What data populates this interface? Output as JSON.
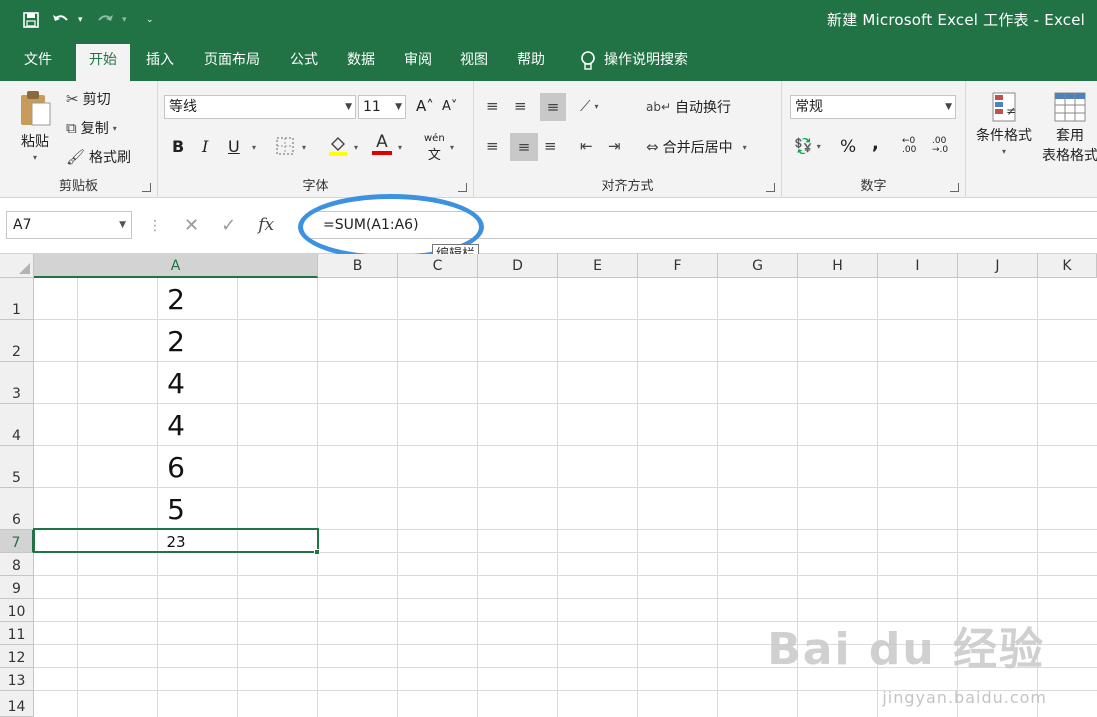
{
  "window": {
    "title": "新建 Microsoft Excel 工作表  -  Excel"
  },
  "tabs": [
    {
      "label": "文件"
    },
    {
      "label": "开始"
    },
    {
      "label": "插入"
    },
    {
      "label": "页面布局"
    },
    {
      "label": "公式"
    },
    {
      "label": "数据"
    },
    {
      "label": "审阅"
    },
    {
      "label": "视图"
    },
    {
      "label": "帮助"
    }
  ],
  "tell_me": "操作说明搜索",
  "ribbon": {
    "clipboard": {
      "label": "剪贴板",
      "paste": "粘贴",
      "cut": "剪切",
      "copy": "复制",
      "format_painter": "格式刷"
    },
    "font": {
      "label": "字体",
      "font_name": "等线",
      "font_size": "11",
      "bold": "B",
      "italic": "I",
      "underline": "U",
      "phonetic": "wén",
      "font_color_glyph": "A"
    },
    "alignment": {
      "label": "对齐方式",
      "wrap_text": "自动换行",
      "merge_center": "合并后居中"
    },
    "number": {
      "label": "数字",
      "format": "常规",
      "percent": "%",
      "comma": ","
    },
    "styles": {
      "conditional": "条件格式",
      "table_line1": "套用",
      "table_line2": "表格格式"
    }
  },
  "formula_bar": {
    "name_box": "A7",
    "formula": "=SUM(A1:A6)",
    "tooltip": "编辑栏",
    "fx": "fx"
  },
  "grid": {
    "columns": [
      "A",
      "B",
      "C",
      "D",
      "E",
      "F",
      "G",
      "H",
      "I",
      "J",
      "K"
    ],
    "rows": [
      "1",
      "2",
      "3",
      "4",
      "5",
      "6",
      "7",
      "8",
      "9",
      "10",
      "11",
      "12",
      "13",
      "14"
    ],
    "values": [
      "2",
      "2",
      "4",
      "4",
      "6",
      "5",
      "23"
    ],
    "selected_cell": "A7"
  },
  "watermark": {
    "brand": "Bai du 经验",
    "url": "jingyan.baidu.com"
  }
}
